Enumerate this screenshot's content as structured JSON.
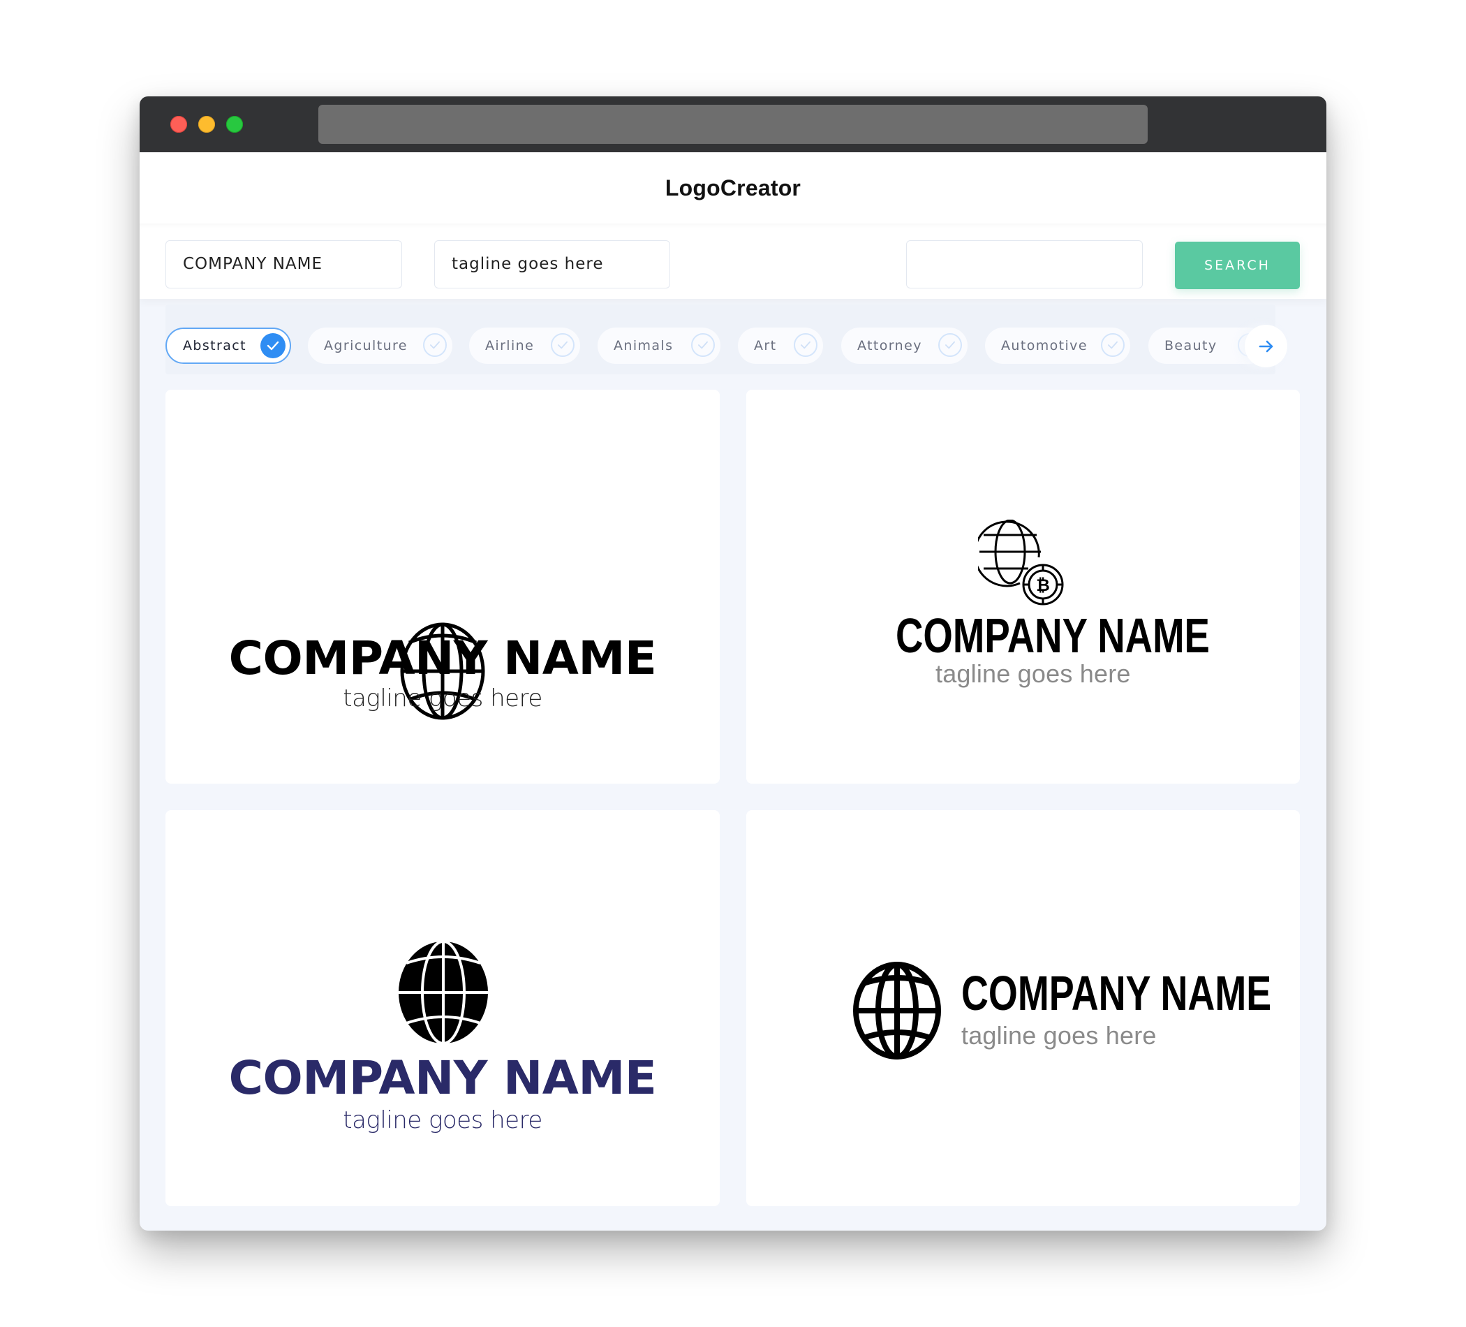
{
  "browser": {
    "traffic_lights": [
      "close",
      "minimize",
      "maximize"
    ],
    "url": ""
  },
  "header": {
    "title": "LogoCreator"
  },
  "search_form": {
    "company_name_value": "COMPANY NAME",
    "tagline_value": "tagline goes here",
    "keyword_value": "",
    "search_button_label": "SEARCH",
    "accent_color": "#5ac9a1"
  },
  "categories": {
    "items": [
      {
        "label": "Abstract",
        "selected": true
      },
      {
        "label": "Agriculture",
        "selected": false
      },
      {
        "label": "Airline",
        "selected": false
      },
      {
        "label": "Animals",
        "selected": false
      },
      {
        "label": "Art",
        "selected": false
      },
      {
        "label": "Attorney",
        "selected": false
      },
      {
        "label": "Automotive",
        "selected": false
      },
      {
        "label": "Beauty",
        "selected": false
      }
    ],
    "next_icon": "arrow-right-icon",
    "selected_color": "#2f8df3"
  },
  "logos": [
    {
      "icon": "globe-outline-icon",
      "company_name": "COMPANY NAME",
      "tagline": "tagline goes here",
      "name_color": "#000000",
      "tagline_color": "#222222",
      "layout": "stacked"
    },
    {
      "icon": "globe-bitcoin-icon",
      "company_name": "COMPANY NAME",
      "tagline": "tagline goes here",
      "name_color": "#000000",
      "tagline_color": "#8a8a8a",
      "layout": "stacked"
    },
    {
      "icon": "globe-filled-icon",
      "company_name": "COMPANY NAME",
      "tagline": "tagline goes here",
      "name_color": "#2a2a68",
      "tagline_color": "#2a2a68",
      "layout": "stacked"
    },
    {
      "icon": "globe-thick-icon",
      "company_name": "COMPANY NAME",
      "tagline": "tagline goes here",
      "name_color": "#000000",
      "tagline_color": "#8a8a8a",
      "layout": "horizontal"
    }
  ]
}
